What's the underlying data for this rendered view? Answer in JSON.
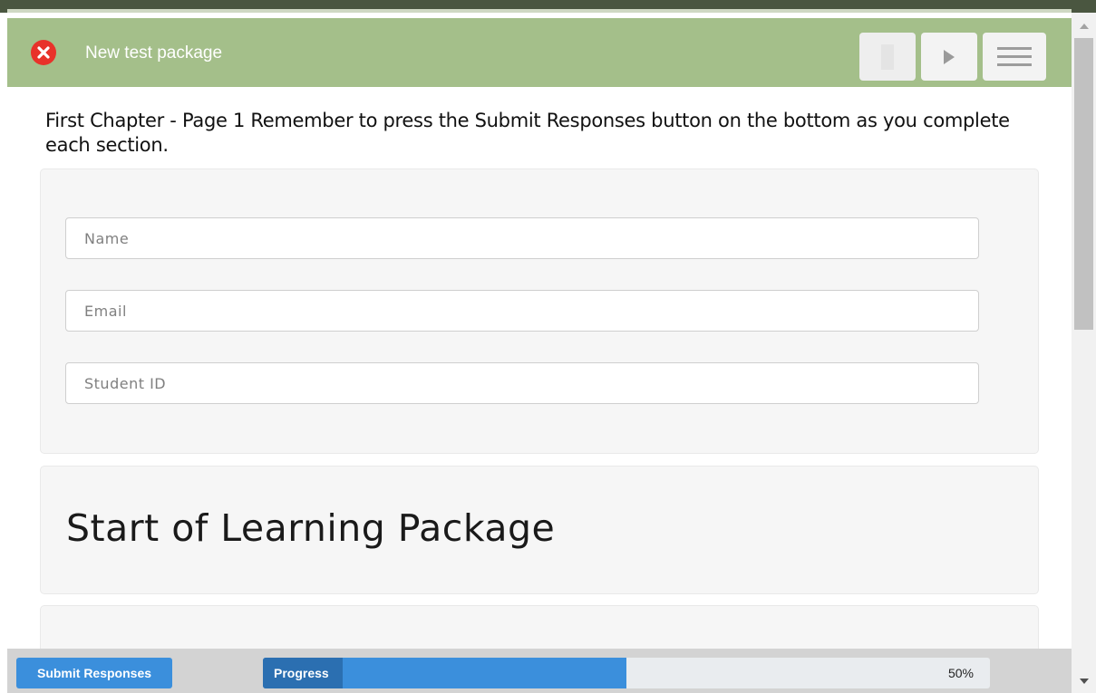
{
  "header": {
    "title": "New test package",
    "close_icon": "close-icon",
    "prev_icon": "previous-page-icon",
    "next_icon": "next-page-icon",
    "menu_icon": "menu-icon"
  },
  "content": {
    "instructions": "First Chapter - Page 1 Remember to press the Submit Responses button on the bottom as you complete each section.",
    "form": {
      "name_placeholder": "Name",
      "email_placeholder": "Email",
      "student_id_placeholder": "Student ID"
    },
    "section_heading": "Start of Learning Package"
  },
  "footer": {
    "submit_label": "Submit Responses",
    "progress_label": "Progress",
    "progress_percent_text": "50%",
    "progress_value": 0.5
  },
  "colors": {
    "header_bg": "#a4bf8a",
    "accent_blue": "#3b8fdc",
    "close_red": "#e8322a"
  }
}
